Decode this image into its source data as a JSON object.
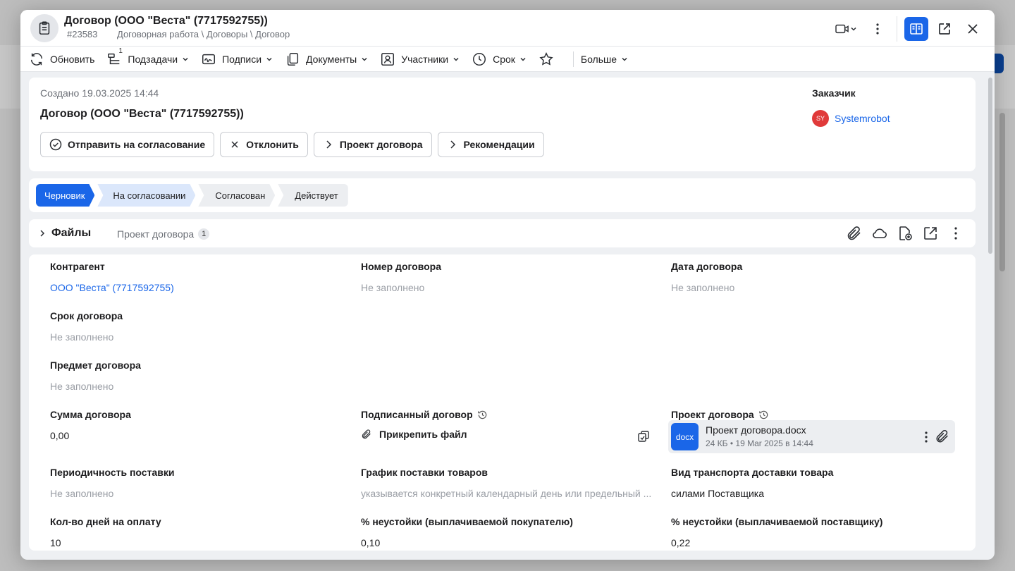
{
  "window": {
    "title": "Договор (ООО \"Веста\" (7717592755))",
    "id": "#23583",
    "path": "Договорная работа \\ Договоры \\ Договор"
  },
  "toolbar": {
    "refresh": "Обновить",
    "subtasks": "Подзадачи",
    "subtasks_count": "1",
    "signatures": "Подписи",
    "documents": "Документы",
    "participants": "Участники",
    "deadline": "Срок",
    "more": "Больше"
  },
  "header": {
    "created": "Создано 19.03.2025 14:44",
    "title": "Договор (ООО \"Веста\" (7717592755))",
    "actions": [
      "Отправить на согласование",
      "Отклонить",
      "Проект договора",
      "Рекомендации"
    ],
    "customer_label": "Заказчик",
    "customer_initials": "SY",
    "customer_name": "Systemrobot"
  },
  "stages": [
    "Черновик",
    "На согласовании",
    "Согласован",
    "Действует"
  ],
  "files": {
    "title": "Файлы",
    "tab": "Проект договора",
    "count": "1"
  },
  "fields": {
    "counterparty": {
      "label": "Контрагент",
      "value": "ООО \"Веста\" (7717592755)"
    },
    "number": {
      "label": "Номер договора",
      "value": "Не заполнено"
    },
    "date": {
      "label": "Дата договора",
      "value": "Не заполнено"
    },
    "term": {
      "label": "Срок договора",
      "value": "Не заполнено"
    },
    "subject": {
      "label": "Предмет договора",
      "value": "Не заполнено"
    },
    "amount": {
      "label": "Сумма договора",
      "value": "0,00"
    },
    "signed": {
      "label": "Подписанный договор",
      "value": "Прикрепить файл"
    },
    "draft": {
      "label": "Проект договора"
    },
    "periodicity": {
      "label": "Периодичность поставки",
      "value": "Не заполнено"
    },
    "schedule": {
      "label": "График поставки товаров",
      "value": "указывается конкретный календарный день или предельный ..."
    },
    "transport": {
      "label": "Вид транспорта доставки товара",
      "value": "силами Поставщика"
    },
    "pay_days": {
      "label": "Кол-во дней на оплату",
      "value": "10"
    },
    "penalty_buyer": {
      "label": "% неустойки (выплачиваемой покупателю)",
      "value": "0,10"
    },
    "penalty_supplier": {
      "label": "% неустойки (выплачиваемой поставщику)",
      "value": "0,22"
    }
  },
  "file_chip": {
    "ext": "docx",
    "name": "Проект договора.docx",
    "meta": "24 КБ • 19 Мar 2025 в 14:44"
  },
  "colors": {
    "accent": "#1a66e8",
    "stage_active": "#1a66e8",
    "stage_next": "#dbe7fb",
    "stage_rest": "#eceef1",
    "avatar": "#e03a3a"
  }
}
